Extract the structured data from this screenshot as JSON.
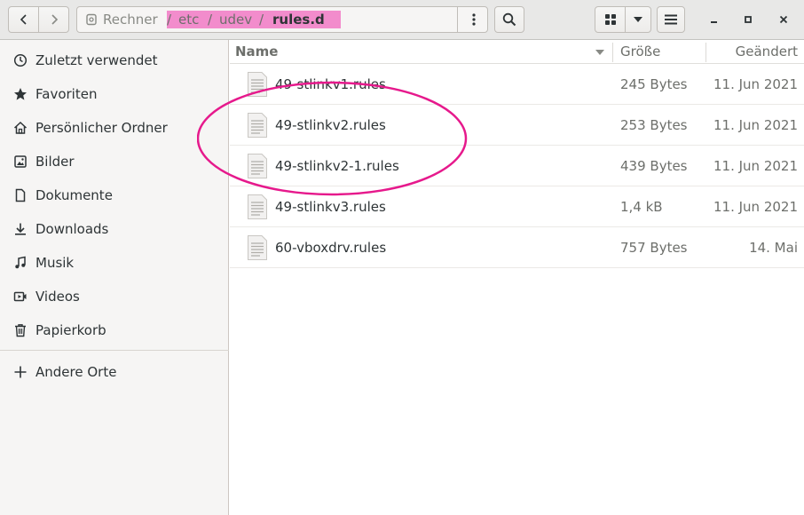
{
  "header": {
    "path": {
      "root_label": "Rechner",
      "segments": [
        "etc",
        "udev"
      ],
      "separator": "/",
      "current": "rules.d"
    },
    "icons": {
      "back": "chevron-left-icon",
      "forward": "chevron-right-icon",
      "path_menu": "vertical-dots-icon",
      "search": "search-icon",
      "view": "grid-view-icon",
      "view_options": "triangle-down-icon",
      "menu": "hamburger-icon",
      "minimize": "minimize-icon",
      "maximize": "maximize-icon",
      "close": "close-icon"
    }
  },
  "sidebar": {
    "items": [
      {
        "label": "Zuletzt verwendet",
        "icon": "clock-icon",
        "selected": true
      },
      {
        "label": "Favoriten",
        "icon": "star-icon"
      },
      {
        "label": "Persönlicher Ordner",
        "icon": "home-icon"
      },
      {
        "label": "Bilder",
        "icon": "image-icon"
      },
      {
        "label": "Dokumente",
        "icon": "document-icon"
      },
      {
        "label": "Downloads",
        "icon": "download-icon"
      },
      {
        "label": "Musik",
        "icon": "music-icon"
      },
      {
        "label": "Videos",
        "icon": "video-icon"
      },
      {
        "label": "Papierkorb",
        "icon": "trash-icon"
      }
    ],
    "other_places": {
      "label": "Andere Orte",
      "icon": "plus-icon"
    }
  },
  "filelist": {
    "columns": {
      "name": "Name",
      "size": "Größe",
      "modified": "Geändert"
    },
    "files": [
      {
        "name": "49-stlinkv1.rules",
        "size": "245 Bytes",
        "modified": "11. Jun 2021"
      },
      {
        "name": "49-stlinkv2.rules",
        "size": "253 Bytes",
        "modified": "11. Jun 2021"
      },
      {
        "name": "49-stlinkv2-1.rules",
        "size": "439 Bytes",
        "modified": "11. Jun 2021"
      },
      {
        "name": "49-stlinkv3.rules",
        "size": "1,4 kB",
        "modified": "11. Jun 2021"
      },
      {
        "name": "60-vboxdrv.rules",
        "size": "757 Bytes",
        "modified": "14. Mai"
      }
    ]
  },
  "colors": {
    "path_highlight": "#f28ccc",
    "annotation_circle": "#e6198c",
    "headerbar": "#e8e8e7",
    "sidebar": "#f6f5f4"
  }
}
